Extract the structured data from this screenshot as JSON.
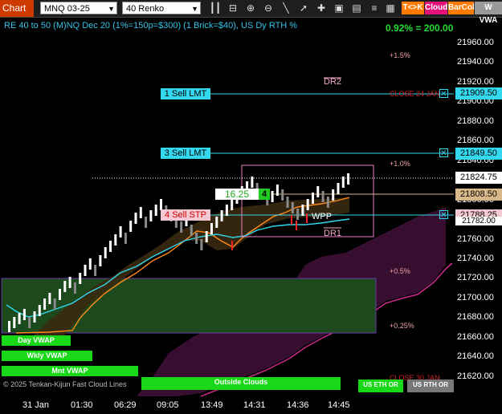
{
  "toolbar": {
    "title": "Chart",
    "instrument": "MNQ 03-25",
    "bar_type": "40 Renko",
    "buttons": [
      {
        "label": "T<>K",
        "color": "#ff7a00"
      },
      {
        "label": "Cloud",
        "color": "#e8117a"
      },
      {
        "label": "BarCol",
        "color": "#ff7a00"
      },
      {
        "label": "W VWA",
        "color": "#9a9a9a"
      }
    ]
  },
  "chart": {
    "header": "RE 40 to 50 (M)NQ Dec 20 (1%=150p=$300) (1 Brick=$40), US Dy RTH %",
    "pct_summary": "0.92% = 200.00",
    "y_ticks": [
      "21960.00",
      "21940.00",
      "21920.00",
      "21900.00",
      "21880.00",
      "21860.00",
      "21840.00",
      "21820.00",
      "21800.00",
      "21780.00",
      "21760.00",
      "21740.00",
      "21720.00",
      "21700.00",
      "21680.00",
      "21660.00",
      "21640.00",
      "21620.00"
    ],
    "x_ticks": [
      "31 Jan",
      "01:30",
      "06:29",
      "09:05",
      "13:49",
      "14:31",
      "14:36",
      "14:45"
    ],
    "price_boxes": [
      {
        "value": "21909.50",
        "bg": "#33d8ee"
      },
      {
        "value": "21849.50",
        "bg": "#33d8ee"
      },
      {
        "value": "21824.75",
        "bg": "#ffffff"
      },
      {
        "value": "21808.50",
        "bg": "#d8b888"
      },
      {
        "value": "21788.25",
        "bg": "#f4c8d0"
      },
      {
        "value": "21782.00",
        "bg": "#ffffff"
      }
    ],
    "orders": [
      {
        "label": "1 Sell LMT",
        "bg": "#33d8ee"
      },
      {
        "label": "3 Sell LMT",
        "bg": "#33d8ee"
      },
      {
        "label": "4 Sell STP",
        "bg": "#f4c8d0"
      }
    ],
    "position": {
      "pnl": "16.25",
      "qty": "4"
    },
    "annotations": {
      "p15": "+1.5%",
      "close24": "CLOSE 24 JAN",
      "dr2": "DR2",
      "p10": "+1.0%",
      "wpp": "WPP",
      "dr1": "DR1",
      "p05": "+0.5%",
      "p025": "+0.25%",
      "close30": "CLOSE 30 JAN"
    },
    "legend_strips": [
      "Day VWAP",
      "Wkly VWAP",
      "Mnt VWAP",
      "Outside Clouds",
      "US ETH OR",
      "US RTH OR"
    ],
    "copyright": "© 2025 Tenkan-Kijun Fast Cloud Lines"
  },
  "colors": {
    "accent_cyan": "#33d8ee",
    "up": "#ffffff",
    "down": "#888888",
    "sell": "#ff2222",
    "vwap_zone": "#1a4a1a"
  }
}
